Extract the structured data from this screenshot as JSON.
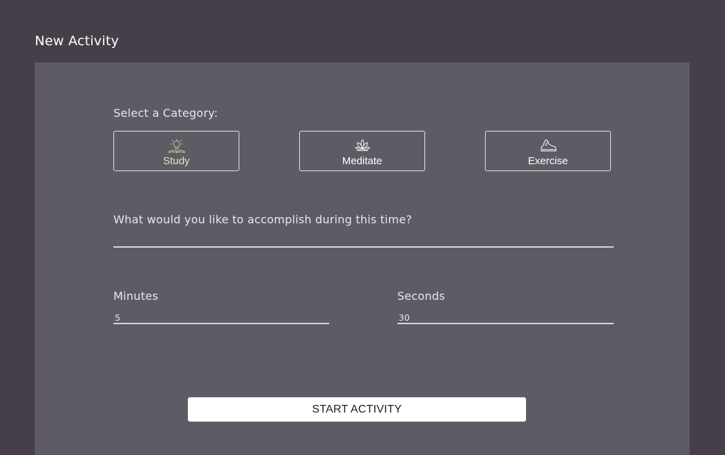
{
  "page": {
    "title": "New Activity"
  },
  "category": {
    "label": "Select a Category:",
    "options": [
      {
        "label": "Study",
        "icon": "lightbulb-book-icon",
        "selected": true,
        "color": "#d8f0b0"
      },
      {
        "label": "Meditate",
        "icon": "lotus-icon",
        "selected": false
      },
      {
        "label": "Exercise",
        "icon": "sneaker-icon",
        "selected": false
      }
    ]
  },
  "goal": {
    "label": "What would you like to accomplish during this time?",
    "value": ""
  },
  "minutes": {
    "label": "Minutes",
    "value": "5"
  },
  "seconds": {
    "label": "Seconds",
    "value": "30"
  },
  "actions": {
    "start_label": "START ACTIVITY"
  },
  "colors": {
    "background": "#463f4a",
    "panel": "#5e5b65",
    "accent": "#d8f0b0",
    "button": "#ffffff"
  }
}
